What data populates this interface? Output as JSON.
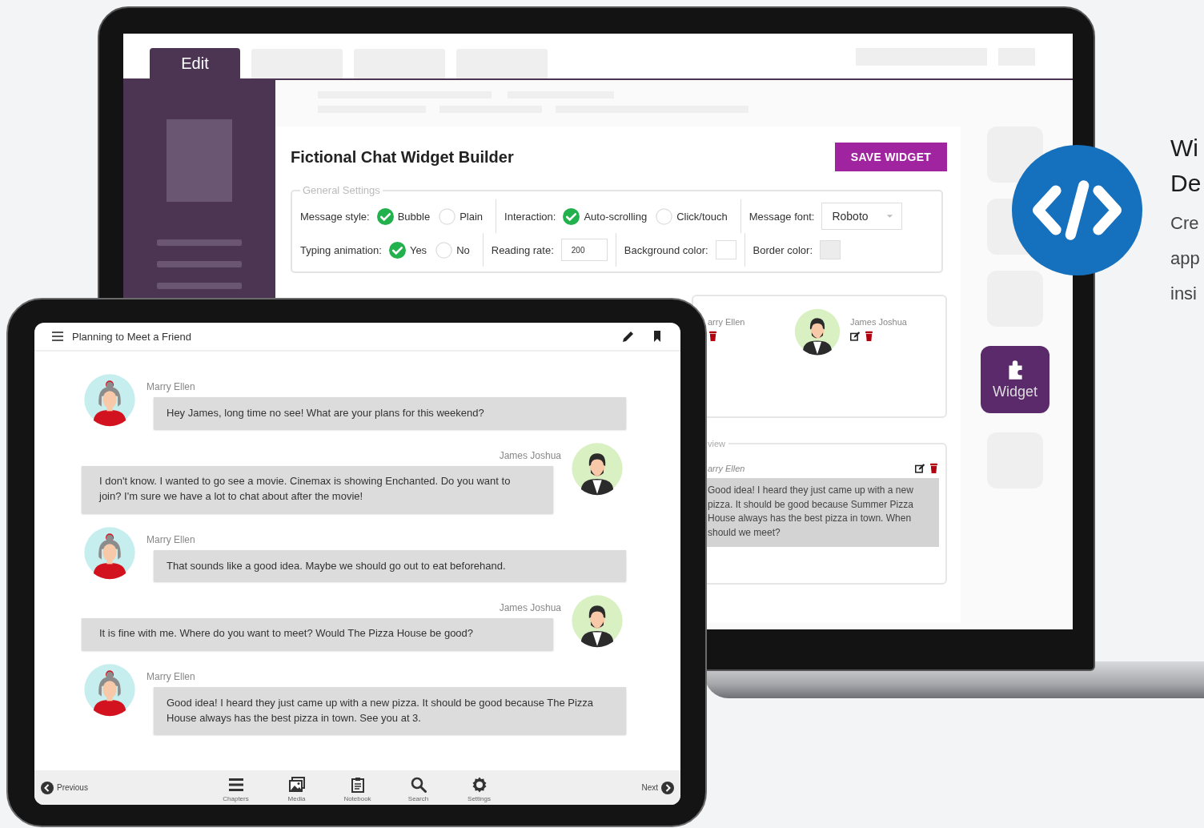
{
  "laptop": {
    "tabs": [
      {
        "label": "Edit",
        "selected": true
      }
    ],
    "builder": {
      "title": "Fictional Chat Widget Builder",
      "save_button": "SAVE WIDGET",
      "settings": {
        "legend": "General Settings",
        "lines": [
          {
            "fields": [
              {
                "kind": "radio",
                "label": "Message style:",
                "options": [
                  {
                    "label": "Bubble",
                    "selected": true
                  },
                  {
                    "label": "Plain",
                    "selected": false
                  }
                ]
              },
              {
                "kind": "radio",
                "label": "Interaction:",
                "options": [
                  {
                    "label": "Auto-scrolling",
                    "selected": true
                  },
                  {
                    "label": "Click/touch",
                    "selected": false
                  }
                ]
              },
              {
                "kind": "select",
                "label": "Message font:",
                "value": "Roboto"
              }
            ]
          },
          {
            "fields": [
              {
                "kind": "radio",
                "label": "Typing animation:",
                "options": [
                  {
                    "label": "Yes",
                    "selected": true
                  },
                  {
                    "label": "No",
                    "selected": false
                  }
                ]
              },
              {
                "kind": "input",
                "label": "Reading rate:",
                "value": "200"
              },
              {
                "kind": "color",
                "label": "Background color:",
                "color": "#ffffff"
              },
              {
                "kind": "color",
                "label": "Border color:",
                "color": "#ececec"
              }
            ]
          }
        ]
      }
    },
    "speakers": [
      {
        "name": "arry Ellen",
        "kind": "cut"
      },
      {
        "name": "James Joshua",
        "kind": "full"
      }
    ],
    "preview": {
      "legend": "view",
      "speaker": "arry Ellen",
      "text": "Good idea! I heard they just came up with a new pizza. It should be good because Summer Pizza House always has the best pizza in town. When should we meet?"
    },
    "widget_button": {
      "label": "Widget"
    }
  },
  "intro": {
    "heading_lines": [
      "Wi",
      "De"
    ],
    "body_lines": [
      "Cre",
      "app",
      "insi"
    ]
  },
  "tablet": {
    "title": "Planning to Meet a Friend",
    "messages": [
      {
        "speaker": "Marry Ellen",
        "kind": "left",
        "text": "Hey James, long time no see! What are your plans for this weekend?"
      },
      {
        "speaker": "James Joshua",
        "kind": "right",
        "text": "I don't know. I wanted to go see a movie. Cinemax is showing Enchanted. Do you want to join? I'm sure we have a lot to chat about after the movie!"
      },
      {
        "speaker": "Marry Ellen",
        "kind": "left",
        "text": "That sounds like a good idea. Maybe we should go out to eat beforehand."
      },
      {
        "speaker": "James Joshua",
        "kind": "right",
        "text": "It is fine with me. Where do you want to meet? Would The Pizza House be good?"
      },
      {
        "speaker": "Marry Ellen",
        "kind": "left",
        "text": "Good idea! I heard they just came up with a new pizza. It should be good because The Pizza House always has the best pizza in town. See you at 3."
      }
    ],
    "nav": {
      "previous": "Previous",
      "next": "Next",
      "items": [
        {
          "label": "Chapters"
        },
        {
          "label": "Media"
        },
        {
          "label": "Notebook"
        },
        {
          "label": "Search"
        },
        {
          "label": "Settings"
        }
      ]
    }
  }
}
